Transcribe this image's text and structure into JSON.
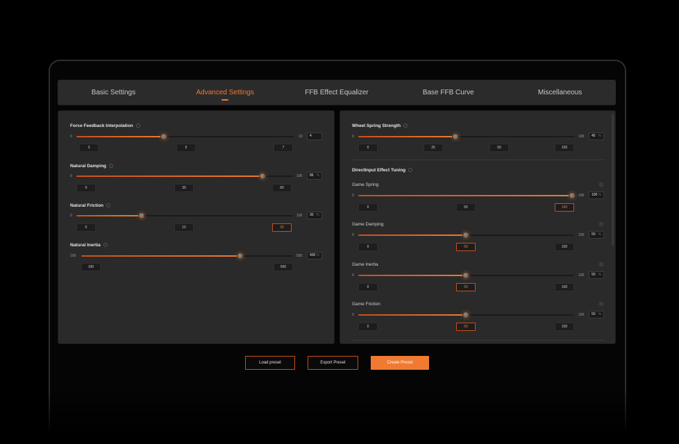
{
  "tabs": [
    "Basic Settings",
    "Advanced Settings",
    "FFB Effect Equalizer",
    "Base FFB Curve",
    "Miscellaneous"
  ],
  "active_tab": "Advanced Settings",
  "accent_color": "#f07a32",
  "left": {
    "interp": {
      "label": "Force Feedback Interpolation",
      "min": "0",
      "max": "10",
      "value": "4",
      "unit": "",
      "level": 0.4,
      "presets": [
        "3",
        "5",
        "7"
      ]
    },
    "damping": {
      "label": "Natural Damping",
      "min": "0",
      "max": "100",
      "value": "86",
      "unit": "%",
      "level": 0.86,
      "presets": [
        "0",
        "30",
        "60"
      ]
    },
    "friction": {
      "label": "Natural Friction",
      "min": "0",
      "max": "100",
      "value": "30",
      "unit": "%",
      "level": 0.3,
      "presets": [
        "0",
        "10",
        "30"
      ]
    },
    "inertia": {
      "label": "Natural Inertia",
      "min": "100",
      "max": "500",
      "value": "400",
      "unit": "%",
      "level": 0.75,
      "presets": [
        "100",
        "500"
      ]
    }
  },
  "right": {
    "spring": {
      "label": "Wheel Spring Strength",
      "min": "0",
      "max": "100",
      "value": "45",
      "unit": "%",
      "level": 0.45,
      "presets": [
        "0",
        "25",
        "50",
        "100"
      ]
    },
    "section_title": "DirectInput Effect Tuning",
    "game_spring": {
      "label": "Game Spring",
      "min": "0",
      "max": "100",
      "value": "100",
      "unit": "%",
      "level": 1.0,
      "presets": [
        "0",
        "50",
        "100"
      ]
    },
    "game_damping": {
      "label": "Game Damping",
      "min": "0",
      "max": "100",
      "value": "50",
      "unit": "%",
      "level": 0.5,
      "presets": [
        "0",
        "50",
        "100"
      ]
    },
    "game_inertia": {
      "label": "Game Inertia",
      "min": "0",
      "max": "100",
      "value": "50",
      "unit": "%",
      "level": 0.5,
      "presets": [
        "0",
        "50",
        "100"
      ]
    },
    "game_friction": {
      "label": "Game Friction",
      "min": "0",
      "max": "100",
      "value": "50",
      "unit": "%",
      "level": 0.5,
      "presets": [
        "0",
        "50",
        "100"
      ]
    }
  },
  "buttons": {
    "load": "Load preset",
    "export": "Export Preset",
    "create": "Create Preset"
  }
}
